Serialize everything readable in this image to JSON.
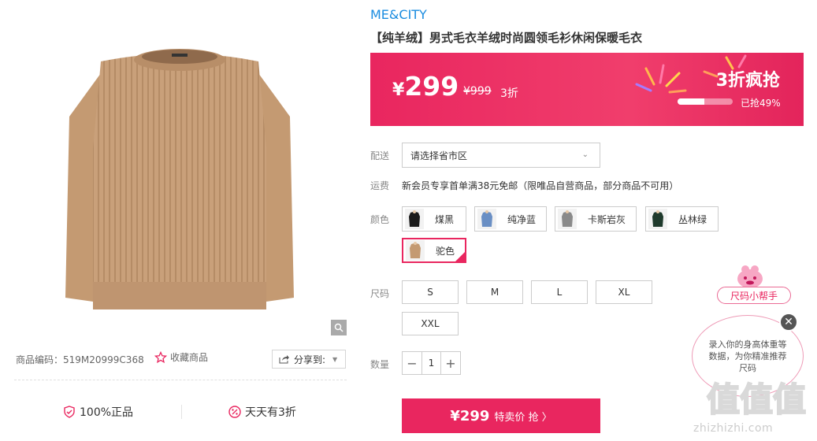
{
  "product": {
    "sku_label": "商品编码：519M20999C368",
    "favorite_label": "收藏商品",
    "share_label": "分享到:",
    "guarantee_1": "100%正品",
    "guarantee_2": "天天有3折"
  },
  "brand": "ME&CITY",
  "title": "【纯羊绒】男式毛衣羊绒时尚圆领毛衫休闲保暖毛衣",
  "banner": {
    "currency": "¥",
    "price": "299",
    "original": "¥999",
    "discount": "3折",
    "flash_label": "3折疯抢",
    "sold_label": "已抢49%",
    "sold_fraction": 0.49
  },
  "delivery": {
    "label": "配送",
    "placeholder": "请选择省市区"
  },
  "shipping": {
    "label": "运费",
    "text": "新会员专享首单满38元免邮（限唯品自营商品，部分商品不可用）"
  },
  "color": {
    "label": "颜色",
    "options": [
      {
        "name": "煤黑",
        "swatch": "#1c1c1c"
      },
      {
        "name": "纯净蓝",
        "swatch": "#6a8fc4"
      },
      {
        "name": "卡斯岩灰",
        "swatch": "#8a8a8a"
      },
      {
        "name": "丛林绿",
        "swatch": "#1f3a2c"
      },
      {
        "name": "驼色",
        "swatch": "#c49a72"
      }
    ],
    "selected": "驼色"
  },
  "size": {
    "label": "尺码",
    "options": [
      "S",
      "M",
      "L",
      "XL",
      "XXL"
    ]
  },
  "quantity": {
    "label": "数量",
    "value": "1",
    "minus": "−",
    "plus": "+"
  },
  "buy": {
    "price": "¥299",
    "label": "特卖价 抢 〉"
  },
  "helper": {
    "tag": "尺码小帮手",
    "bubble": "录入你的身高体重等数据，为你精准推荐尺码",
    "close": "✕"
  },
  "watermark": {
    "logo": "值值值",
    "site": "zhizhizhi.com"
  },
  "colors": {
    "accent": "#e9265f",
    "brand_blue": "#1a8ce0"
  }
}
